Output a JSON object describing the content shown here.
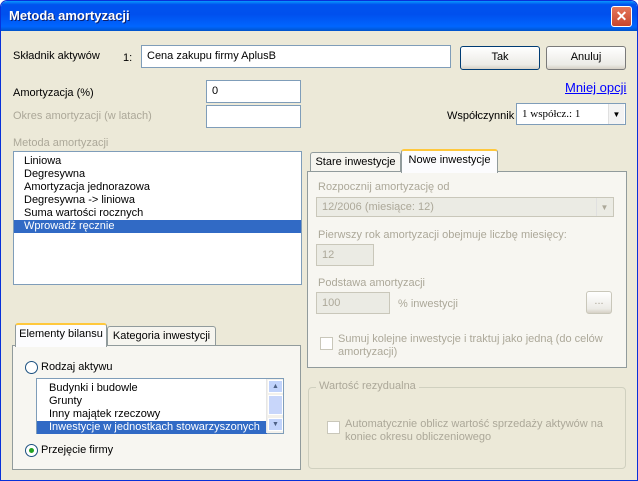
{
  "window": {
    "title": "Metoda amortyzacji",
    "close": "✕"
  },
  "skladnik": {
    "label": "Składnik aktywów",
    "index": "1:",
    "value": "Cena zakupu firmy AplusB"
  },
  "buttons": {
    "ok": "Tak",
    "cancel": "Anuluj",
    "ellipsis": "..."
  },
  "amortyzacja": {
    "label": "Amortyzacja (%)",
    "value": "0"
  },
  "okres": {
    "label": "Okres amortyzacji (w latach)",
    "value": ""
  },
  "less_options": "Mniej opcji",
  "wspolczynnik": {
    "label": "Współczynnik",
    "value": "1 współcz.: 1"
  },
  "metoda": {
    "label": "Metoda amortyzacji",
    "items": [
      "Liniowa",
      "Degresywna",
      "Amortyzacja jednorazowa",
      "Degresywna -> liniowa",
      "Suma wartości rocznych",
      "Wprowadź ręcznie"
    ],
    "selected": 5
  },
  "tabs_right": {
    "tab1": "Stare inwestycje",
    "tab2": "Nowe inwestycje",
    "active": 2
  },
  "nowe": {
    "start_label": "Rozpocznij amortyzację od",
    "start_value": "12/2006 (miesiące: 12)",
    "first_year_label": "Pierwszy rok amortyzacji obejmuje liczbę miesięcy:",
    "first_year_value": "12",
    "base_label": "Podstawa amortyzacji",
    "base_value": "100",
    "base_unit": "% inwestycji",
    "sum_label_1": "Sumuj kolejne inwestycje i traktuj jako jedną (do celów",
    "sum_label_2": "amortyzacji)"
  },
  "residual": {
    "legend": "Wartość rezydualna",
    "auto_label_1": "Automatycznie oblicz wartość sprzedaży aktywów na",
    "auto_label_2": "koniec okresu obliczeniowego"
  },
  "tabs_left": {
    "tab1": "Elementy bilansu",
    "tab2": "Kategoria inwestycji",
    "active": 1
  },
  "bilans": {
    "radio1": "Rodzaj aktywu",
    "radio2": "Przejęcie firmy",
    "selected_radio": 2,
    "items": [
      "Budynki i budowle",
      "Grunty",
      "Inny majątek rzeczowy",
      "Inwestycje w jednostkach stowarzyszonych"
    ],
    "selected": 3
  }
}
